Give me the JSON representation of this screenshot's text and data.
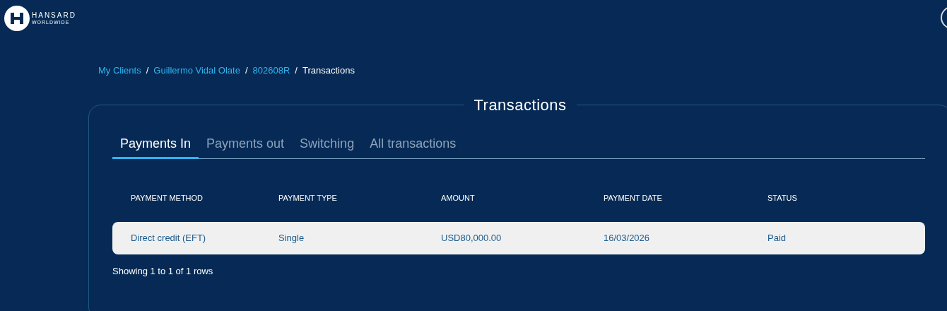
{
  "header": {
    "logo": {
      "name": "HANSARD",
      "tagline": "WORLDWIDE"
    }
  },
  "breadcrumb": [
    {
      "label": "My Clients",
      "link": true
    },
    {
      "label": "Guillermo Vidal Olate",
      "link": true
    },
    {
      "label": "802608R",
      "link": true
    },
    {
      "label": "Transactions",
      "link": false
    }
  ],
  "breadcrumb_separator": "/",
  "card": {
    "title": "Transactions"
  },
  "tabs": [
    {
      "label": "Payments In",
      "selected": true
    },
    {
      "label": "Payments out",
      "selected": false
    },
    {
      "label": "Switching",
      "selected": false
    },
    {
      "label": "All transactions",
      "selected": false
    }
  ],
  "table": {
    "columns": [
      "PAYMENT METHOD",
      "PAYMENT TYPE",
      "AMOUNT",
      "PAYMENT DATE",
      "STATUS"
    ],
    "rows": [
      [
        "Direct credit (EFT)",
        "Single",
        "USD80,000.00",
        "16/03/2026",
        "Paid"
      ]
    ]
  },
  "footer_text": "Showing 1 to 1 of 1 rows"
}
